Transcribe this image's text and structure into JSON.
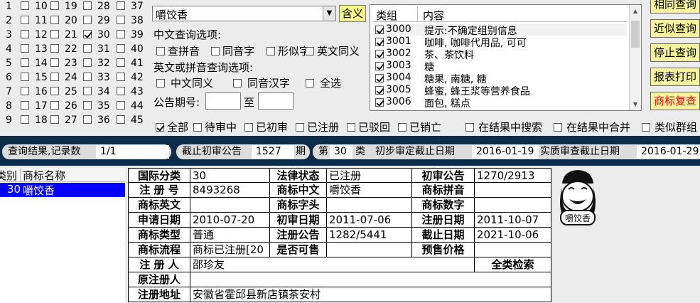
{
  "number_grid": [
    [
      "1",
      "10",
      "19",
      "28",
      "37"
    ],
    [
      "2",
      "11",
      "20",
      "29",
      "38"
    ],
    [
      "3",
      "12",
      "21",
      "30",
      "39"
    ],
    [
      "4",
      "13",
      "22",
      "31",
      "40"
    ],
    [
      "5",
      "14",
      "23",
      "32",
      "41"
    ],
    [
      "6",
      "15",
      "24",
      "33",
      "42"
    ],
    [
      "7",
      "16",
      "25",
      "34",
      "43"
    ],
    [
      "8",
      "17",
      "26",
      "35",
      "44"
    ],
    [
      "9",
      "18",
      "27",
      "36",
      "45"
    ]
  ],
  "number_checked": [
    "30"
  ],
  "search": {
    "query": "嚼饺香",
    "hanyi_label": "含义",
    "chinese_options_label": "中文查询选项:",
    "chinese_options": [
      "查拼音",
      "同音字",
      "形似字",
      "英文同义"
    ],
    "en_pinyin_options_label": "英文或拼音查询选项:",
    "en_pinyin_options": [
      "中文同义",
      "同音汉字",
      "全选"
    ],
    "announcement_label": "公告期号:",
    "announcement_to": "至",
    "announcement_from_value": "",
    "announcement_to_value": ""
  },
  "class_table": {
    "headers": [
      "类组",
      "内容"
    ],
    "rows": [
      {
        "code": "3000",
        "desc": "提示:不确定组别信息",
        "checked": true
      },
      {
        "code": "3001",
        "desc": "咖啡, 咖啡代用品, 可可",
        "checked": true
      },
      {
        "code": "3002",
        "desc": "茶、茶饮料",
        "checked": true
      },
      {
        "code": "3003",
        "desc": "糖",
        "checked": true
      },
      {
        "code": "3004",
        "desc": "糖果, 南糖, 糖",
        "checked": true
      },
      {
        "code": "3005",
        "desc": "蜂蜜, 蜂王浆等营养食品",
        "checked": true
      },
      {
        "code": "3006",
        "desc": "面包, 糕点",
        "checked": true
      }
    ]
  },
  "right_buttons": [
    "相同查询",
    "近似查询",
    "停止查询",
    "报表打印",
    "商标复查"
  ],
  "status_filters": [
    {
      "label": "全部",
      "checked": true
    },
    {
      "label": "待审中",
      "checked": false
    },
    {
      "label": "已初审",
      "checked": false
    },
    {
      "label": "已注册",
      "checked": false
    },
    {
      "label": "已驳回",
      "checked": false
    },
    {
      "label": "已销亡",
      "checked": false
    }
  ],
  "search_filters": [
    {
      "label": "在结果中搜索",
      "checked": false
    },
    {
      "label": "在结果中合并",
      "checked": false
    },
    {
      "label": "类似群组",
      "checked": false
    }
  ],
  "result_bar": {
    "count_label": "查询结果,记录数",
    "count_value": "1/1",
    "cutoff_label": "截止初审公告",
    "cutoff_value": "1527",
    "cutoff_unit": "期",
    "class_prefix": "第",
    "class_value": "30",
    "class_suffix": "类",
    "prelim_label": "初步审定截止日期",
    "prelim_value": "2016-01-19",
    "substantive_label": "实质审查截止日期",
    "substantive_value": "2016-01-29"
  },
  "result_list": {
    "headers": [
      "类别",
      "商标名称"
    ],
    "rows": [
      {
        "class": "30",
        "name": "嚼饺香"
      }
    ]
  },
  "detail": {
    "intl_class_label": "国际分类",
    "intl_class": "30",
    "legal_status_label": "法律状态",
    "legal_status": "已注册",
    "prelim_pub_label": "初审公告",
    "prelim_pub": "1270/2913",
    "reg_no_label": "注 册 号",
    "reg_no": "8493268",
    "tm_cn_label": "商标中文",
    "tm_cn": "嚼饺香",
    "tm_pinyin_label": "商标拼音",
    "tm_pinyin": "",
    "tm_en_label": "商标英文",
    "tm_en": "",
    "tm_head_label": "商标字头",
    "tm_head": "",
    "tm_digits_label": "商标数字",
    "tm_digits": "",
    "apply_date_label": "申请日期",
    "apply_date": "2010-07-20",
    "prelim_date_label": "初审日期",
    "prelim_date": "2011-07-06",
    "reg_date_label": "注册日期",
    "reg_date": "2011-10-07",
    "tm_type_label": "商标类型",
    "tm_type": "普通",
    "reg_pub_label": "注册公告",
    "reg_pub": "1282/5441",
    "expiry_label": "截止日期",
    "expiry": "2021-10-06",
    "flow_label": "商标流程",
    "flow": "商标已注册[20",
    "tradable_label": "是否可售",
    "tradable": "",
    "presale_label": "预售价格",
    "presale": "",
    "registrant_label": "注 册 人",
    "registrant": "邵珍友",
    "all_class_label": "全类检索",
    "orig_registrant_label": "原注册人",
    "orig_registrant": "",
    "address_label": "注册地址",
    "address": "安徽省霍邱县新店镇茶安村"
  },
  "logo": {
    "text": "嚼饺香"
  }
}
